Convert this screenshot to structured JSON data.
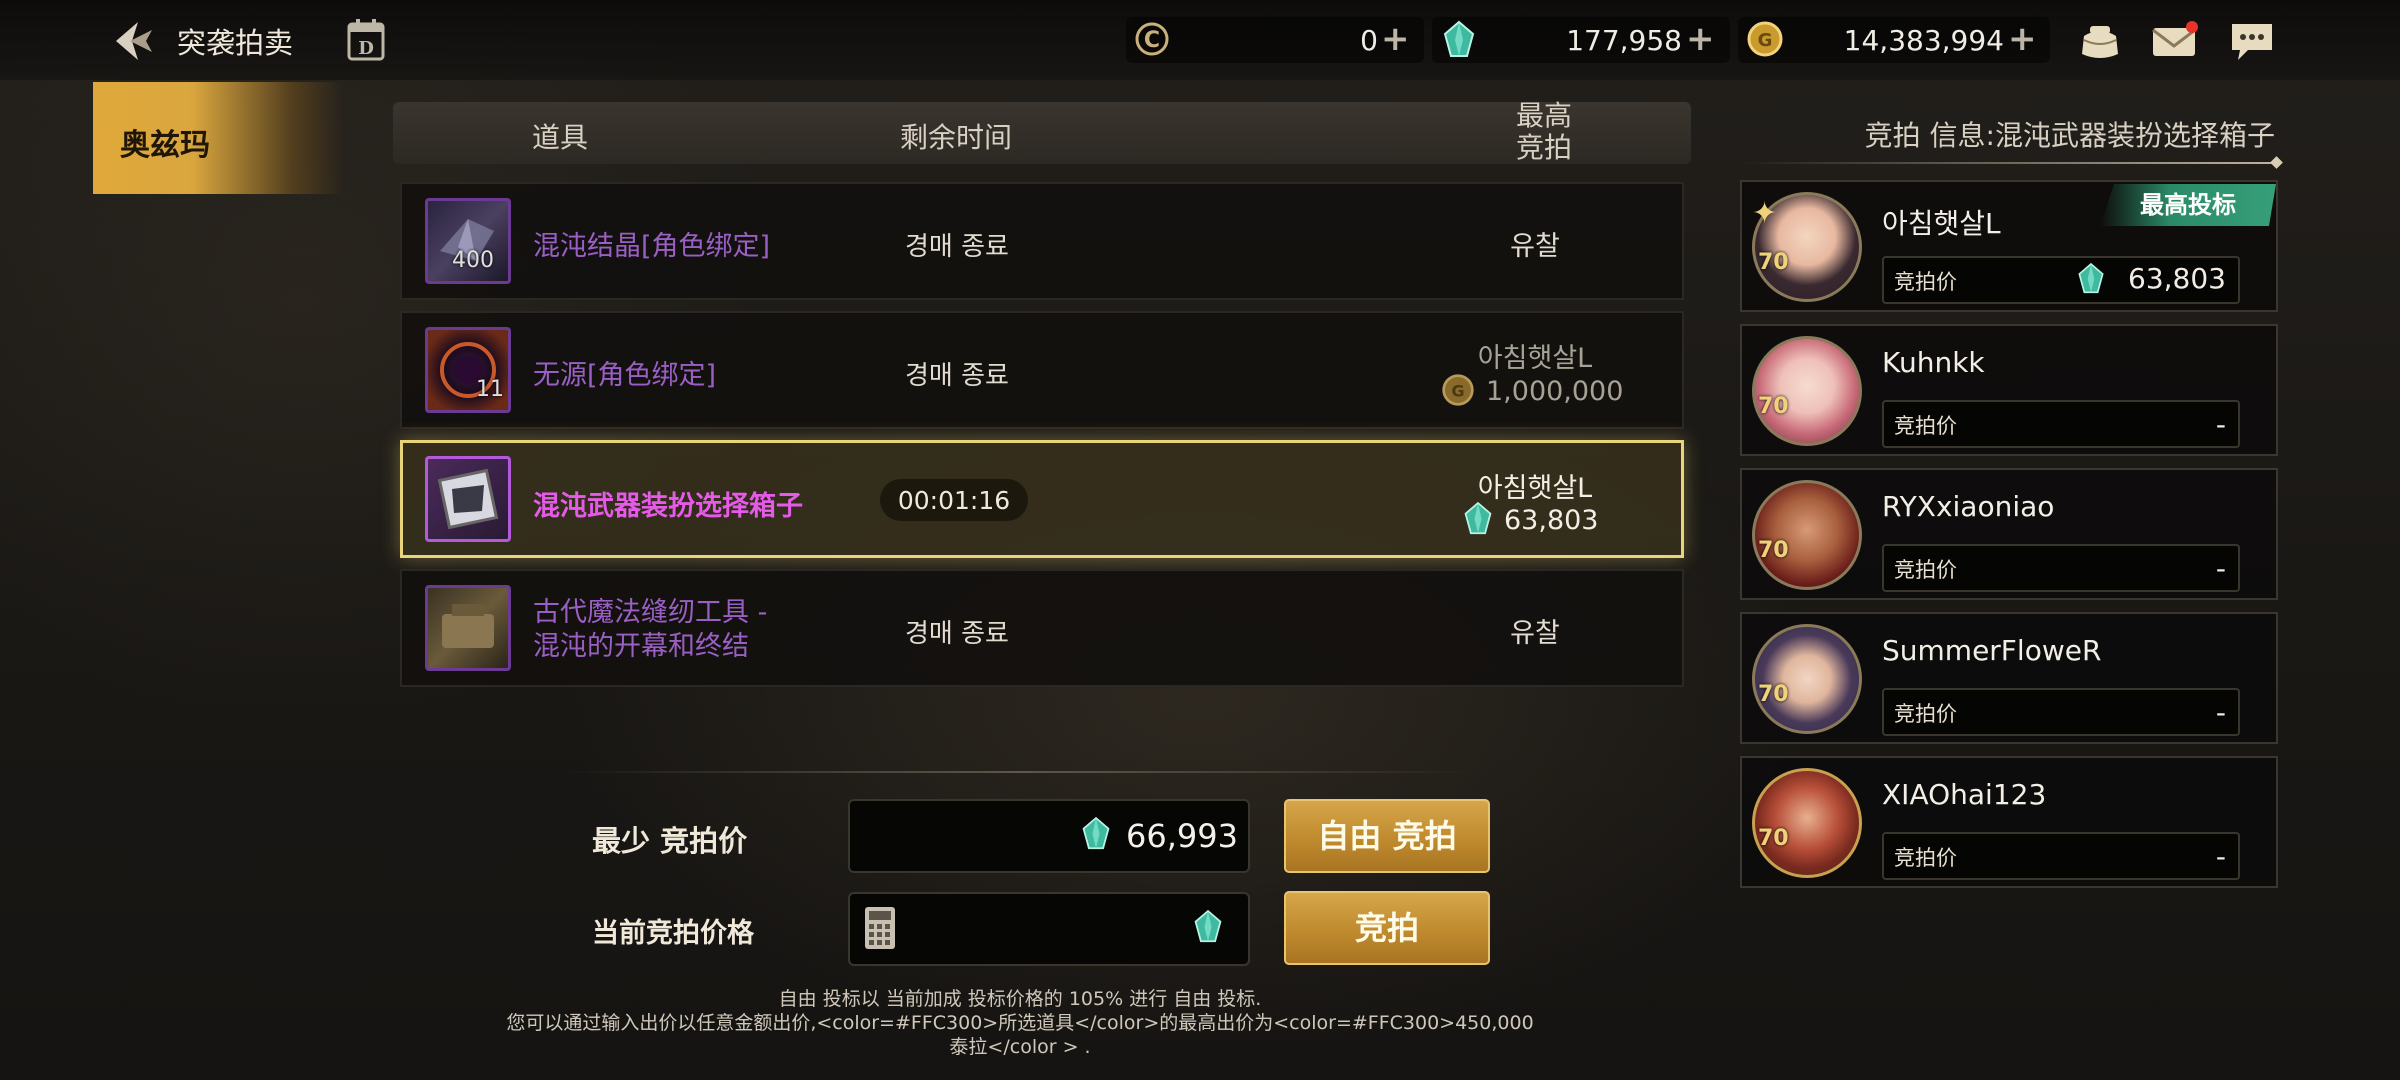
{
  "header": {
    "title": "突袭拍卖",
    "currencies": [
      {
        "icon": "c-coin-icon",
        "value": "0"
      },
      {
        "icon": "gem-icon",
        "value": "177,958"
      },
      {
        "icon": "gold-coin-icon",
        "value": "14,383,994"
      }
    ]
  },
  "sidebar": {
    "tabs": [
      {
        "label": "奥兹玛"
      }
    ]
  },
  "list": {
    "columns": {
      "item": "道具",
      "time": "剩余时间",
      "bid_line1": "最高",
      "bid_line2": "竞拍"
    },
    "rows": [
      {
        "name": "混沌结晶[角色绑定]",
        "qty": "400",
        "time": "경매 종료",
        "result": "유찰"
      },
      {
        "name": "无源[角色绑定]",
        "qty": "11",
        "time": "경매 종료",
        "bidder": "아침햇살L",
        "amount": "1,000,000"
      },
      {
        "name": "混沌武器装扮选择箱子",
        "time": "00:01:16",
        "bidder": "아침햇살L",
        "amount": "63,803"
      },
      {
        "name_line1": "古代魔法缝纫工具 -",
        "name_line2": "混沌的开幕和终结",
        "time": "경매 종료",
        "result": "유찰"
      }
    ]
  },
  "bid": {
    "min_label": "最少 竞拍价",
    "min_value": "66,993",
    "free_button": "自由 竞拍",
    "current_label": "当前竞拍价格",
    "bid_button": "竞拍",
    "note_line1": "自由 投标以 当前加成 投标价格的 105% 进行 自由 投标.",
    "note_line2": "您可以通过输入出价以任意金额出价,<color=#FFC300>所选道具</color>的最高出价为<color=#FFC300>450,000",
    "note_line3": "泰拉</color > ."
  },
  "panel": {
    "title": "竞拍 信息:混沌武器装扮选择箱子",
    "badge": "最高投标",
    "bid_label": "竞拍价",
    "bidders": [
      {
        "name": "아침햇살L",
        "level": "70",
        "value": "63,803"
      },
      {
        "name": "Kuhnkk",
        "level": "70",
        "value": "-"
      },
      {
        "name": "RYXxiaoniao",
        "level": "70",
        "value": "-"
      },
      {
        "name": "SummerFloweR",
        "level": "70",
        "value": "-"
      },
      {
        "name": "XIAOhai123",
        "level": "70",
        "value": "-"
      }
    ]
  },
  "colors": {
    "accent_gold": "#d6a64a",
    "item_purple": "#9a5fc4",
    "item_active": "#e55be8",
    "selected_border": "#e8d57a"
  }
}
